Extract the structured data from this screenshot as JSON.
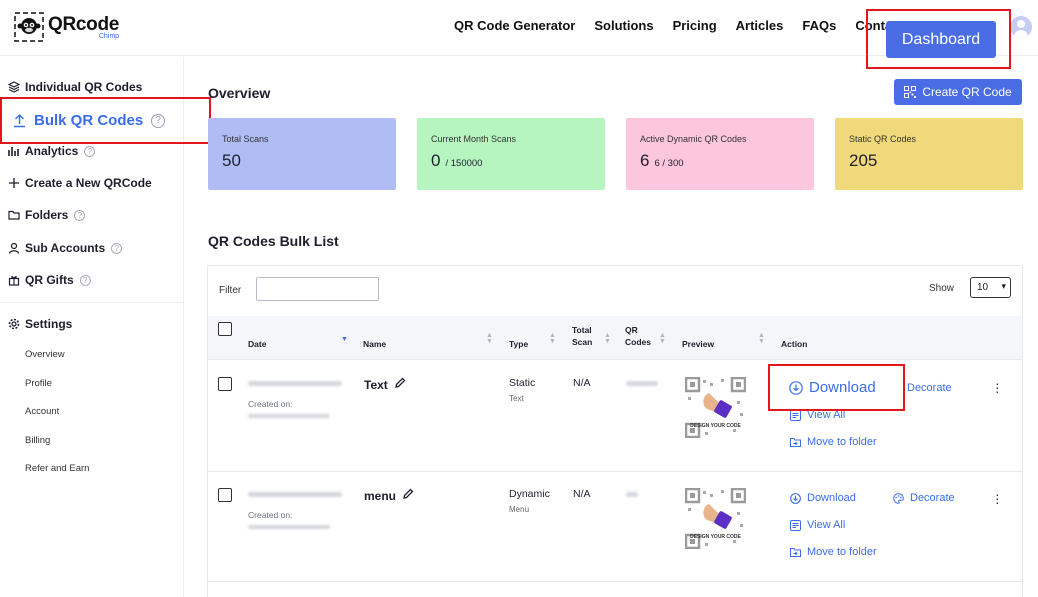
{
  "brand": {
    "name": "QRcode",
    "sub": "Chimp"
  },
  "nav": {
    "items": [
      "QR Code Generator",
      "Solutions",
      "Pricing",
      "Articles",
      "FAQs",
      "Contac"
    ],
    "dashboard_label": "Dashboard"
  },
  "sidebar": {
    "items": [
      {
        "label": "Individual QR Codes",
        "icon": "stack-icon"
      },
      {
        "label": "Bulk QR Codes",
        "icon": "upload-icon"
      },
      {
        "label": "Analytics",
        "icon": "bar-chart-icon"
      },
      {
        "label": "Create a New QRCode",
        "icon": "plus-icon"
      },
      {
        "label": "Folders",
        "icon": "folder-icon"
      },
      {
        "label": "Sub Accounts",
        "icon": "user-icon"
      },
      {
        "label": "QR Gifts",
        "icon": "gift-icon"
      }
    ],
    "settings_label": "Settings",
    "settings_items": [
      "Overview",
      "Profile",
      "Account",
      "Billing",
      "Refer and Earn"
    ]
  },
  "overview": {
    "title": "Overview",
    "create_button": "Create QR Code",
    "cards": [
      {
        "label": "Total Scans",
        "value": "50",
        "suffix": "",
        "color": "#b0bdf5"
      },
      {
        "label": "Current Month Scans",
        "value": "0",
        "suffix": "/ 150000",
        "color": "#b6f5c0"
      },
      {
        "label": "Active Dynamic QR Codes",
        "value": "6",
        "suffix": "6  / 300",
        "color": "#fcc6dc"
      },
      {
        "label": "Static QR Codes",
        "value": "205",
        "suffix": "",
        "color": "#f0d97a"
      }
    ]
  },
  "bulk_list": {
    "title": "QR Codes Bulk List",
    "filter_label": "Filter",
    "filter_value": "",
    "show_label": "Show",
    "show_value": "10",
    "columns": [
      "Date",
      "Name",
      "Type",
      "Total Scan",
      "QR Codes",
      "Preview",
      "Action"
    ],
    "created_on_label": "Created on:",
    "preview_text": "DESIGN YOUR CODE",
    "rows": [
      {
        "name": "Text",
        "type": "Static",
        "type_sub": "Text",
        "total_scan": "N/A"
      },
      {
        "name": "menu",
        "type": "Dynamic",
        "type_sub": "Menu",
        "total_scan": "N/A"
      }
    ],
    "actions": {
      "download": "Download",
      "decorate": "Decorate",
      "view_all": "View All",
      "move": "Move to folder"
    }
  },
  "colors": {
    "accent": "#4a6de5",
    "link": "#3a6ee8",
    "highlight": "#e3161c"
  }
}
